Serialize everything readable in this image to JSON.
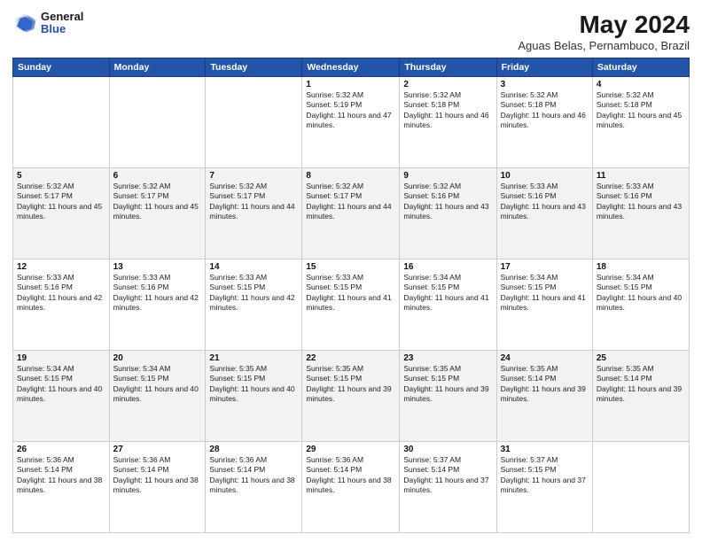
{
  "header": {
    "logo_general": "General",
    "logo_blue": "Blue",
    "title": "May 2024",
    "subtitle": "Aguas Belas, Pernambuco, Brazil"
  },
  "days_of_week": [
    "Sunday",
    "Monday",
    "Tuesday",
    "Wednesday",
    "Thursday",
    "Friday",
    "Saturday"
  ],
  "weeks": [
    [
      {
        "day": "",
        "detail": ""
      },
      {
        "day": "",
        "detail": ""
      },
      {
        "day": "",
        "detail": ""
      },
      {
        "day": "1",
        "detail": "Sunrise: 5:32 AM\nSunset: 5:19 PM\nDaylight: 11 hours and 47 minutes."
      },
      {
        "day": "2",
        "detail": "Sunrise: 5:32 AM\nSunset: 5:18 PM\nDaylight: 11 hours and 46 minutes."
      },
      {
        "day": "3",
        "detail": "Sunrise: 5:32 AM\nSunset: 5:18 PM\nDaylight: 11 hours and 46 minutes."
      },
      {
        "day": "4",
        "detail": "Sunrise: 5:32 AM\nSunset: 5:18 PM\nDaylight: 11 hours and 45 minutes."
      }
    ],
    [
      {
        "day": "5",
        "detail": "Sunrise: 5:32 AM\nSunset: 5:17 PM\nDaylight: 11 hours and 45 minutes."
      },
      {
        "day": "6",
        "detail": "Sunrise: 5:32 AM\nSunset: 5:17 PM\nDaylight: 11 hours and 45 minutes."
      },
      {
        "day": "7",
        "detail": "Sunrise: 5:32 AM\nSunset: 5:17 PM\nDaylight: 11 hours and 44 minutes."
      },
      {
        "day": "8",
        "detail": "Sunrise: 5:32 AM\nSunset: 5:17 PM\nDaylight: 11 hours and 44 minutes."
      },
      {
        "day": "9",
        "detail": "Sunrise: 5:32 AM\nSunset: 5:16 PM\nDaylight: 11 hours and 43 minutes."
      },
      {
        "day": "10",
        "detail": "Sunrise: 5:33 AM\nSunset: 5:16 PM\nDaylight: 11 hours and 43 minutes."
      },
      {
        "day": "11",
        "detail": "Sunrise: 5:33 AM\nSunset: 5:16 PM\nDaylight: 11 hours and 43 minutes."
      }
    ],
    [
      {
        "day": "12",
        "detail": "Sunrise: 5:33 AM\nSunset: 5:16 PM\nDaylight: 11 hours and 42 minutes."
      },
      {
        "day": "13",
        "detail": "Sunrise: 5:33 AM\nSunset: 5:16 PM\nDaylight: 11 hours and 42 minutes."
      },
      {
        "day": "14",
        "detail": "Sunrise: 5:33 AM\nSunset: 5:15 PM\nDaylight: 11 hours and 42 minutes."
      },
      {
        "day": "15",
        "detail": "Sunrise: 5:33 AM\nSunset: 5:15 PM\nDaylight: 11 hours and 41 minutes."
      },
      {
        "day": "16",
        "detail": "Sunrise: 5:34 AM\nSunset: 5:15 PM\nDaylight: 11 hours and 41 minutes."
      },
      {
        "day": "17",
        "detail": "Sunrise: 5:34 AM\nSunset: 5:15 PM\nDaylight: 11 hours and 41 minutes."
      },
      {
        "day": "18",
        "detail": "Sunrise: 5:34 AM\nSunset: 5:15 PM\nDaylight: 11 hours and 40 minutes."
      }
    ],
    [
      {
        "day": "19",
        "detail": "Sunrise: 5:34 AM\nSunset: 5:15 PM\nDaylight: 11 hours and 40 minutes."
      },
      {
        "day": "20",
        "detail": "Sunrise: 5:34 AM\nSunset: 5:15 PM\nDaylight: 11 hours and 40 minutes."
      },
      {
        "day": "21",
        "detail": "Sunrise: 5:35 AM\nSunset: 5:15 PM\nDaylight: 11 hours and 40 minutes."
      },
      {
        "day": "22",
        "detail": "Sunrise: 5:35 AM\nSunset: 5:15 PM\nDaylight: 11 hours and 39 minutes."
      },
      {
        "day": "23",
        "detail": "Sunrise: 5:35 AM\nSunset: 5:15 PM\nDaylight: 11 hours and 39 minutes."
      },
      {
        "day": "24",
        "detail": "Sunrise: 5:35 AM\nSunset: 5:14 PM\nDaylight: 11 hours and 39 minutes."
      },
      {
        "day": "25",
        "detail": "Sunrise: 5:35 AM\nSunset: 5:14 PM\nDaylight: 11 hours and 39 minutes."
      }
    ],
    [
      {
        "day": "26",
        "detail": "Sunrise: 5:36 AM\nSunset: 5:14 PM\nDaylight: 11 hours and 38 minutes."
      },
      {
        "day": "27",
        "detail": "Sunrise: 5:36 AM\nSunset: 5:14 PM\nDaylight: 11 hours and 38 minutes."
      },
      {
        "day": "28",
        "detail": "Sunrise: 5:36 AM\nSunset: 5:14 PM\nDaylight: 11 hours and 38 minutes."
      },
      {
        "day": "29",
        "detail": "Sunrise: 5:36 AM\nSunset: 5:14 PM\nDaylight: 11 hours and 38 minutes."
      },
      {
        "day": "30",
        "detail": "Sunrise: 5:37 AM\nSunset: 5:14 PM\nDaylight: 11 hours and 37 minutes."
      },
      {
        "day": "31",
        "detail": "Sunrise: 5:37 AM\nSunset: 5:15 PM\nDaylight: 11 hours and 37 minutes."
      },
      {
        "day": "",
        "detail": ""
      }
    ]
  ]
}
